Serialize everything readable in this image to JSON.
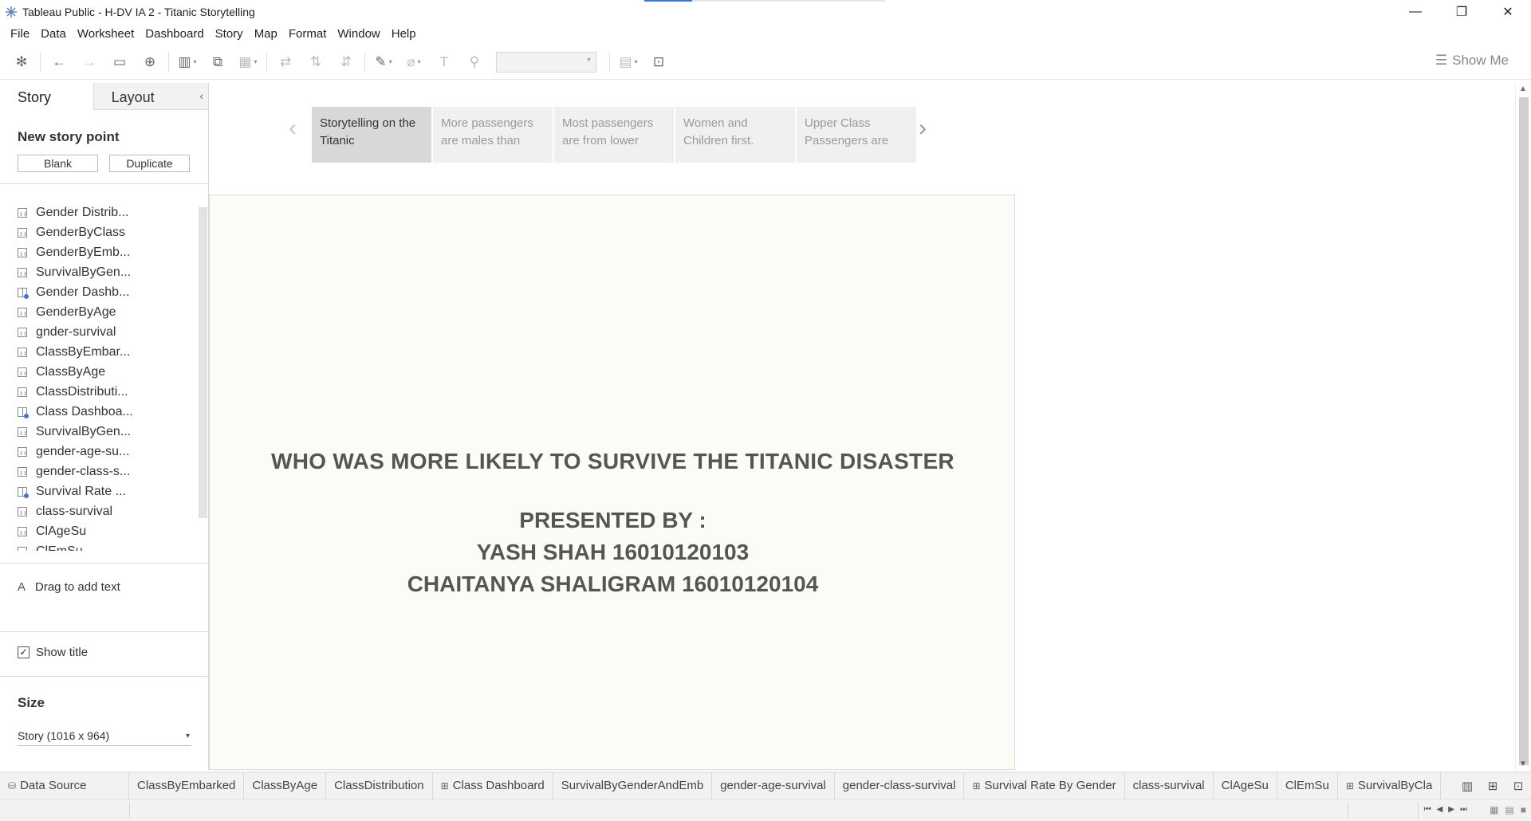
{
  "window": {
    "title": "Tableau Public - H-DV IA 2 - Titanic Storytelling",
    "controls": [
      "—",
      "❐",
      "✕"
    ]
  },
  "menu": [
    "File",
    "Data",
    "Worksheet",
    "Dashboard",
    "Story",
    "Map",
    "Format",
    "Window",
    "Help"
  ],
  "toolbar": {
    "show_me": "Show Me"
  },
  "left_pane": {
    "tabs": {
      "story": "Story",
      "layout": "Layout"
    },
    "new_story_point": "New story point",
    "blank_button": "Blank",
    "duplicate_button": "Duplicate",
    "sheets": [
      {
        "label": "Gender Distrib...",
        "type": "sheet"
      },
      {
        "label": "GenderByClass",
        "type": "sheet"
      },
      {
        "label": "GenderByEmb...",
        "type": "sheet"
      },
      {
        "label": "SurvivalByGen...",
        "type": "sheet"
      },
      {
        "label": "Gender Dashb...",
        "type": "dashboard"
      },
      {
        "label": "GenderByAge",
        "type": "sheet"
      },
      {
        "label": "gnder-survival",
        "type": "sheet"
      },
      {
        "label": "ClassByEmbar...",
        "type": "sheet"
      },
      {
        "label": "ClassByAge",
        "type": "sheet"
      },
      {
        "label": "ClassDistributi...",
        "type": "sheet"
      },
      {
        "label": "Class Dashboa...",
        "type": "dashboard"
      },
      {
        "label": "SurvivalByGen...",
        "type": "sheet"
      },
      {
        "label": "gender-age-su...",
        "type": "sheet"
      },
      {
        "label": "gender-class-s...",
        "type": "sheet"
      },
      {
        "label": "Survival Rate ...",
        "type": "dashboard"
      },
      {
        "label": "class-survival",
        "type": "sheet"
      },
      {
        "label": "ClAgeSu",
        "type": "sheet"
      },
      {
        "label": "ClEmSu",
        "type": "sheet"
      }
    ],
    "drag_to_add_text": "Drag to add text",
    "show_title": "Show title",
    "show_title_checked": true,
    "size_title": "Size",
    "size_value": "Story (1016 x 964)"
  },
  "story": {
    "points": [
      {
        "text": "Storytelling on the Titanic",
        "active": true
      },
      {
        "text": "More passengers are males than",
        "active": false
      },
      {
        "text": "Most passengers are from lower",
        "active": false
      },
      {
        "text": "Women and Children first.",
        "active": false
      },
      {
        "text": "Upper Class Passengers are",
        "active": false
      }
    ],
    "heading": "WHO WAS MORE LIKELY TO SURVIVE THE TITANIC DISASTER",
    "presented_by": "PRESENTED BY :",
    "author1": "YASH SHAH 16010120103",
    "author2": "CHAITANYA SHALIGRAM 16010120104"
  },
  "bottom_tabs": [
    {
      "label": "Data Source",
      "icon": "datasource"
    },
    {
      "label": "ClassByEmbarked",
      "icon": ""
    },
    {
      "label": "ClassByAge",
      "icon": ""
    },
    {
      "label": "ClassDistribution",
      "icon": ""
    },
    {
      "label": "Class Dashboard",
      "icon": "dashboard"
    },
    {
      "label": "SurvivalByGenderAndEmb",
      "icon": ""
    },
    {
      "label": "gender-age-survival",
      "icon": ""
    },
    {
      "label": "gender-class-survival",
      "icon": ""
    },
    {
      "label": "Survival Rate By Gender",
      "icon": "dashboard"
    },
    {
      "label": "class-survival",
      "icon": ""
    },
    {
      "label": "ClAgeSu",
      "icon": ""
    },
    {
      "label": "ClEmSu",
      "icon": ""
    },
    {
      "label": "SurvivalByCla",
      "icon": "dashboard"
    }
  ],
  "colors": {
    "accent": "#3b78d8",
    "canvas": "#fcfcf6",
    "active_story_point": "#d8d8d8"
  }
}
